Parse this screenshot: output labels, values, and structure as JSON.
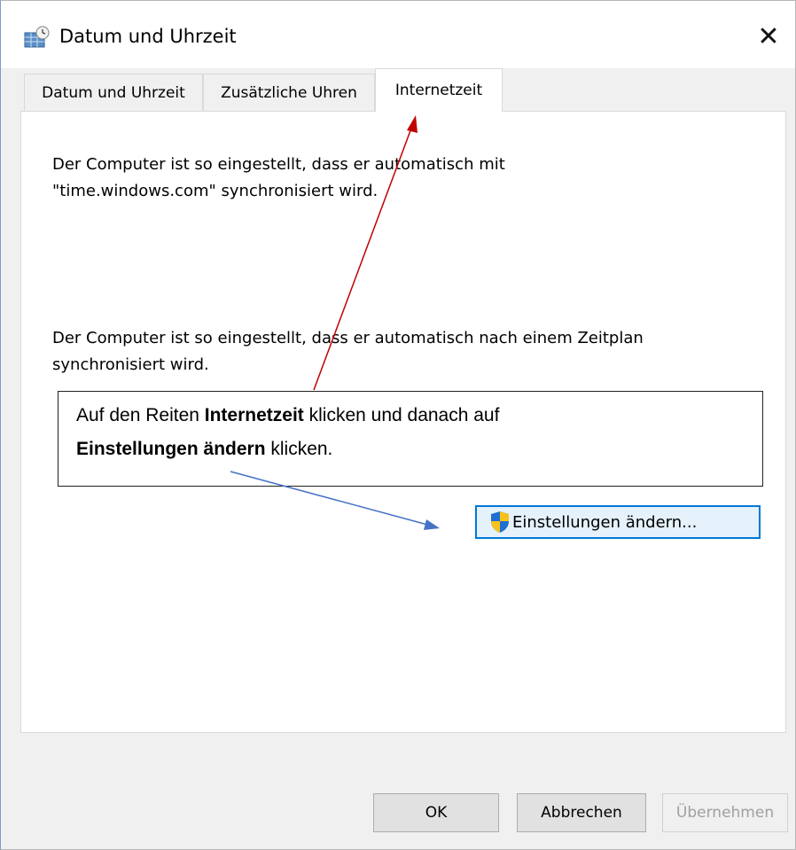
{
  "window": {
    "title": "Datum und Uhrzeit",
    "close_glyph": "✕"
  },
  "tabs": [
    {
      "label": "Datum und Uhrzeit"
    },
    {
      "label": "Zusätzliche Uhren"
    },
    {
      "label": "Internetzeit"
    }
  ],
  "panel": {
    "para1_line1": "Der Computer ist so eingestellt, dass er automatisch mit",
    "para1_line2": "\"time.windows.com\" synchronisiert wird.",
    "para2_line1": "Der Computer ist so eingestellt, dass er automatisch nach einem Zeitplan",
    "para2_line2": "synchronisiert wird.",
    "change_button": "Einstellungen ändern..."
  },
  "annotation": {
    "part1": "Auf den Reiten ",
    "bold1": "Internetzeit",
    "part2": " klicken und danach auf",
    "bold2": "Einstellungen ändern",
    "part3": " klicken.",
    "arrow_colors": {
      "red": "#c00000",
      "blue": "#4472c4"
    }
  },
  "footer": {
    "ok": "OK",
    "cancel": "Abbrechen",
    "apply": "Übernehmen"
  },
  "icons": {
    "app": "datetime-app-icon",
    "shield": "uac-shield-icon",
    "close": "close-icon"
  }
}
